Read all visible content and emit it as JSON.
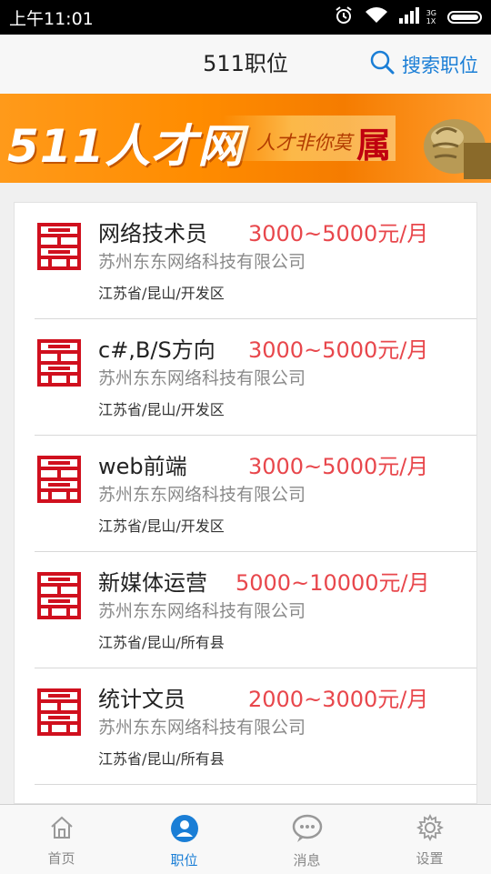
{
  "status_bar": {
    "time": "上午11:01",
    "network": "3G",
    "network_sub": "1X"
  },
  "header": {
    "title": "511职位",
    "search_label": "搜索职位"
  },
  "banner": {
    "brand": "511人才网",
    "slogan": "人才非你莫",
    "slogan_emphasis": "属"
  },
  "jobs": [
    {
      "title": "网络技术员",
      "salary": "3000~5000元/月",
      "company": "苏州东东网络科技有限公司",
      "location": "江苏省/昆山/开发区"
    },
    {
      "title": "c#,B/S方向",
      "salary": "3000~5000元/月",
      "company": "苏州东东网络科技有限公司",
      "location": "江苏省/昆山/开发区"
    },
    {
      "title": "web前端",
      "salary": "3000~5000元/月",
      "company": "苏州东东网络科技有限公司",
      "location": "江苏省/昆山/开发区"
    },
    {
      "title": "新媒体运营",
      "salary": "5000~10000元/月",
      "company": "苏州东东网络科技有限公司",
      "location": "江苏省/昆山/所有县"
    },
    {
      "title": "统计文员",
      "salary": "2000~3000元/月",
      "company": "苏州东东网络科技有限公司",
      "location": "江苏省/昆山/所有县"
    }
  ],
  "tabs": [
    {
      "label": "首页",
      "icon": "home-icon"
    },
    {
      "label": "职位",
      "icon": "user-icon"
    },
    {
      "label": "消息",
      "icon": "chat-icon"
    },
    {
      "label": "设置",
      "icon": "gear-icon"
    }
  ],
  "colors": {
    "accent": "#1a7ed6",
    "salary": "#e8474c",
    "banner": "#ff8c00",
    "logo": "#d0101e"
  }
}
